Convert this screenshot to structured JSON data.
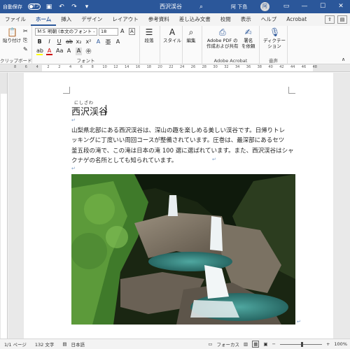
{
  "titlebar": {
    "autosave_label": "自動保存",
    "autosave_state": "オフ",
    "document_title": "西沢渓谷",
    "user_name": "阿 下島",
    "avatar_text": "阿"
  },
  "tabs": [
    "ファイル",
    "ホーム",
    "挿入",
    "デザイン",
    "レイアウト",
    "参考資料",
    "差し込み文書",
    "校閲",
    "表示",
    "ヘルプ",
    "Acrobat"
  ],
  "active_tab": "ホーム",
  "ribbon": {
    "paste_label": "貼り付け",
    "clipboard_label": "クリップボード",
    "font_name": "ＭＳ 明朝 (本文のフォント -",
    "font_size": "18",
    "font_group_label": "フォント",
    "paragraph_label": "段落",
    "style_label": "スタイル",
    "edit_label": "編集",
    "acrobat_btn1_line1": "Adobe PDF の",
    "acrobat_btn1_line2": "作成および共有",
    "acrobat_btn2_line1": "署名",
    "acrobat_btn2_line2": "を依頼",
    "acrobat_group_label": "Adobe Acrobat",
    "dictation_label": "ディクテー",
    "dictation_label2": "ション",
    "voice_group_label": "音声"
  },
  "ruler_numbers": [
    "8",
    "6",
    "4",
    "2",
    "2",
    "4",
    "6",
    "8",
    "10",
    "12",
    "14",
    "16",
    "18",
    "20",
    "22",
    "24",
    "26",
    "28",
    "30",
    "32",
    "34",
    "36",
    "38",
    "40",
    "42",
    "44",
    "46",
    "48"
  ],
  "document": {
    "ruby": "にしざわ",
    "title": "西沢渓谷",
    "body_lines": [
      "山梨県北部にある西沢渓谷は、深山の趣を楽しめる美しい渓谷です。日帰りトレ",
      "ッキングに丁度いい周回コースが整備されています。圧巻は、最深部にあるセツ",
      "釜五段の滝で、この滝は日本の滝 100 選に選ばれています。また、西沢渓谷はシャ",
      "クナゲの名所としても知られています。"
    ]
  },
  "statusbar": {
    "page": "1/1 ページ",
    "words": "132 文字",
    "language": "日本語",
    "focus": "フォーカス",
    "zoom": "100%"
  }
}
